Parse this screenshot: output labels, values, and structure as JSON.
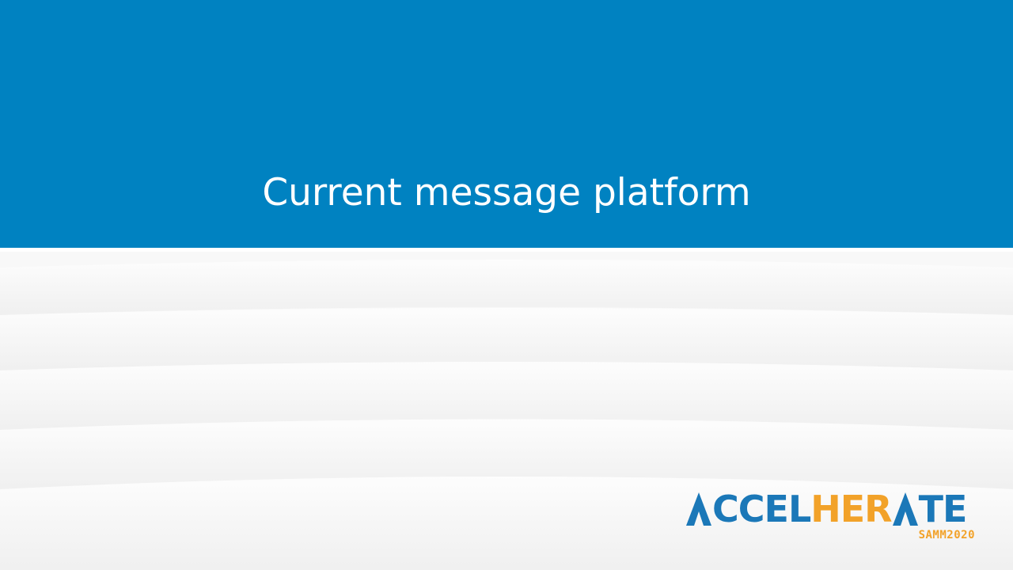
{
  "slide": {
    "title": "Current message platform"
  },
  "logo": {
    "word_part1": "CCEL",
    "word_part2": "HER",
    "word_part3": "TE",
    "full_text": "ACCELHERATE",
    "subtitle": "SAMM2020"
  },
  "colors": {
    "banner": "#0082c1",
    "logo_blue": "#1b78b8",
    "logo_orange": "#f2a229"
  }
}
